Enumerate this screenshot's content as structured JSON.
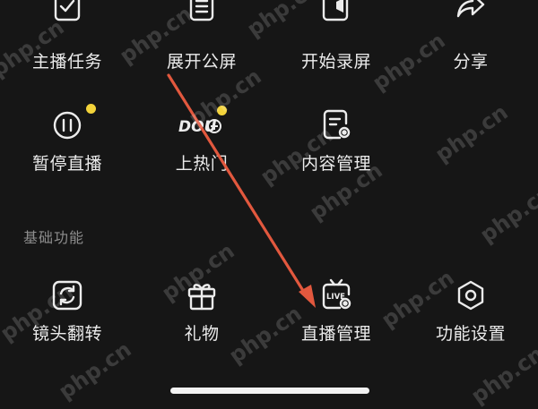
{
  "row1": [
    {
      "label": "主播任务",
      "icon": "task-check-icon"
    },
    {
      "label": "展开公屏",
      "icon": "list-doc-icon"
    },
    {
      "label": "开始录屏",
      "icon": "record-camera-icon"
    },
    {
      "label": "分享",
      "icon": "share-icon"
    }
  ],
  "row2": [
    {
      "label": "暂停直播",
      "icon": "pause-icon",
      "badge": true
    },
    {
      "label": "上热门",
      "icon": "douplus-icon",
      "badge": true,
      "icon_text": "DOU"
    },
    {
      "label": "内容管理",
      "icon": "content-settings-icon"
    }
  ],
  "section": {
    "title": "基础功能"
  },
  "row3": [
    {
      "label": "镜头翻转",
      "icon": "camera-flip-icon"
    },
    {
      "label": "礼物",
      "icon": "gift-icon"
    },
    {
      "label": "直播管理",
      "icon": "live-manage-icon",
      "icon_text": "LIVE"
    },
    {
      "label": "功能设置",
      "icon": "settings-hex-icon"
    }
  ],
  "watermark": "php.cn",
  "colors": {
    "background": "#161616",
    "badge": "#f3d33a",
    "arrow": "#e2583e",
    "text": "#ececec",
    "section": "#8d8d8d"
  }
}
